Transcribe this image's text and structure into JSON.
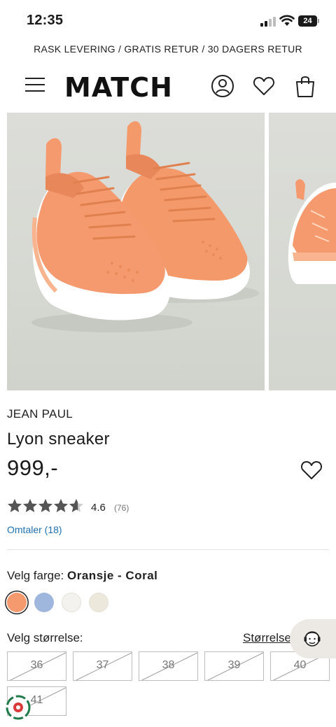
{
  "status_bar": {
    "time": "12:35",
    "battery_level": "24"
  },
  "promo_banner": "RASK LEVERING / GRATIS RETUR / 30 DAGERS RETUR",
  "header": {
    "logo": "MATCH"
  },
  "product": {
    "brand": "JEAN PAUL",
    "name": "Lyon sneaker",
    "price": "999,-",
    "rating": {
      "value": "4.6",
      "count": "(76)",
      "stars": 4.6
    },
    "reviews_link": "Omtaler (18)"
  },
  "color_selector": {
    "label": "Velg farge:",
    "selected": "Oransje - Coral",
    "swatches": [
      "#f59a6e",
      "#9fb7dc",
      "#f3f2ee",
      "#ece8dc"
    ]
  },
  "size_selector": {
    "label": "Velg størrelse:",
    "guide_link": "Størrelse",
    "sizes": [
      "36",
      "37",
      "38",
      "39",
      "40",
      "41"
    ]
  },
  "colors": {
    "accent_link": "#1f6fb0",
    "shoe_orange": "#f3996a",
    "star": "#555555"
  }
}
